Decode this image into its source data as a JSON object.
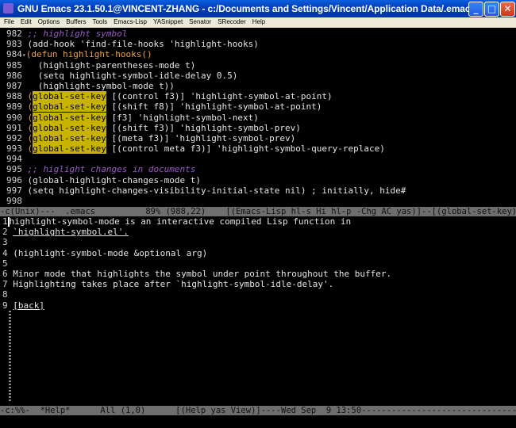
{
  "window": {
    "title": "GNU Emacs 23.1.50.1@VINCENT-ZHANG - c:/Documents and Settings/Vincent/Application Data/.emacs",
    "controls": {
      "minimize": "_",
      "maximize": "□",
      "close": "✕"
    }
  },
  "menubar": [
    "File",
    "Edit",
    "Options",
    "Buffers",
    "Tools",
    "Emacs-Lisp",
    "YASnippet",
    "Senator",
    "SRecoder",
    "Help"
  ],
  "editor": {
    "lines": [
      {
        "num": "982",
        "text": ";; highlight symbol"
      },
      {
        "num": "983",
        "text": "(add-hook 'find-file-hooks 'highlight-hooks)"
      },
      {
        "num": "984",
        "text": "(defun highlight-hooks()"
      },
      {
        "num": "985",
        "text": "  (highlight-parentheses-mode t)"
      },
      {
        "num": "986",
        "text": "  (setq highlight-symbol-idle-delay 0.5)"
      },
      {
        "num": "987",
        "text": "  (highlight-symbol-mode t))"
      },
      {
        "num": "988",
        "text": "(global-set-key [(control f3)] 'highlight-symbol-at-point)"
      },
      {
        "num": "989",
        "text": "(global-set-key [(shift f8)] 'highlight-symbol-at-point)"
      },
      {
        "num": "990",
        "text": "(global-set-key [f3] 'highlight-symbol-next)"
      },
      {
        "num": "991",
        "text": "(global-set-key [(shift f3)] 'highlight-symbol-prev)"
      },
      {
        "num": "992",
        "text": "(global-set-key [(meta f3)] 'highlight-symbol-prev)"
      },
      {
        "num": "993",
        "text": "(global-set-key [(control meta f3)] 'highlight-symbol-query-replace)"
      },
      {
        "num": "994",
        "text": ""
      },
      {
        "num": "995",
        "text": ";; higlight changes in documents"
      },
      {
        "num": "996",
        "text": "(global-highlight-changes-mode t)"
      },
      {
        "num": "997",
        "text": "(setq highlight-changes-visibility-initial-state nil) ; initially, hide#"
      },
      {
        "num": "998",
        "text": ""
      }
    ],
    "modeline": "-c(Unix)---  .emacs          89% (988,22)    [(Emacs-Lisp hl-s Hi hl-p -Chg AC yas)]--[(global-set-key)]"
  },
  "help": {
    "lines": [
      {
        "num": "1",
        "text": "highlight-symbol-mode is an interactive compiled Lisp function in"
      },
      {
        "num": "2",
        "text": "`highlight-symbol.el'."
      },
      {
        "num": "3",
        "text": ""
      },
      {
        "num": "4",
        "text": "(highlight-symbol-mode &optional arg)"
      },
      {
        "num": "5",
        "text": ""
      },
      {
        "num": "6",
        "text": "Minor mode that highlights the symbol under point throughout the buffer."
      },
      {
        "num": "7",
        "text": "Highlighting takes place after `highlight-symbol-idle-delay'."
      },
      {
        "num": "8",
        "text": ""
      },
      {
        "num": "9",
        "text": "[back]"
      }
    ],
    "modeline": "-c:%%-  *Help*      All (1,0)      [(Help yas View)]----Wed Sep  9 13:50-----------------------------------------"
  },
  "colors": {
    "titlebar": "#0340b8",
    "highlight": "#c8b400",
    "comment": "#9a5bc7",
    "keyword": "#f0a040",
    "modeline": "#6e6e6e"
  }
}
